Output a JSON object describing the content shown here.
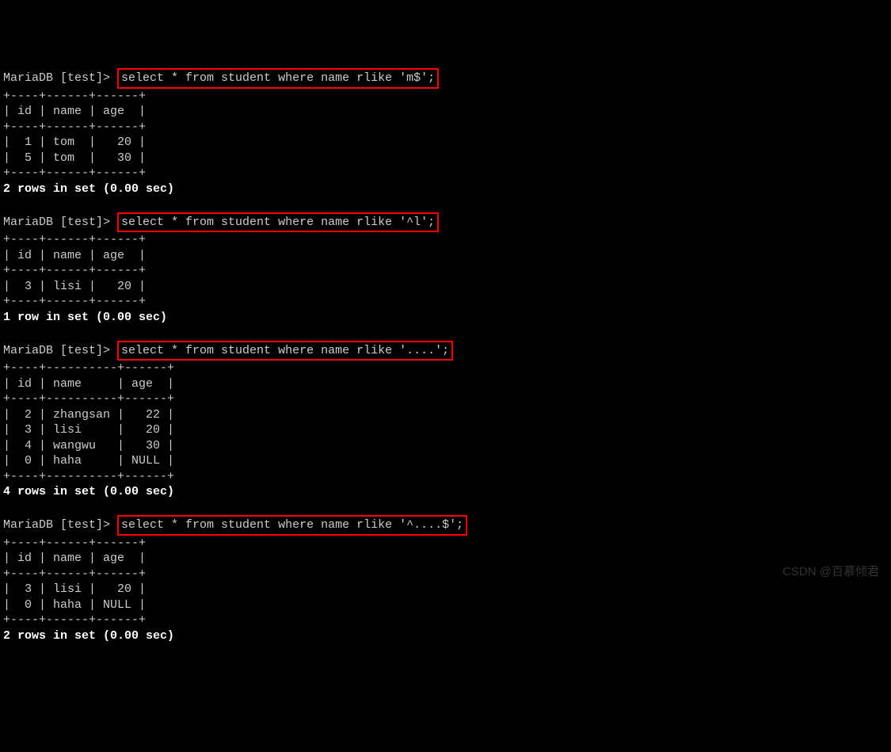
{
  "prompt": "MariaDB [test]> ",
  "queries": [
    {
      "sql": "select * from student where name rlike 'm$';",
      "header": "| id | name | age  |",
      "separator": "+----+------+------+",
      "rows": [
        "|  1 | tom  |   20 |",
        "|  5 | tom  |   30 |"
      ],
      "footer": "2 rows in set (0.00 sec)"
    },
    {
      "sql": "select * from student where name rlike '^l';",
      "header": "| id | name | age  |",
      "separator": "+----+------+------+",
      "rows": [
        "|  3 | lisi |   20 |"
      ],
      "footer": "1 row in set (0.00 sec)"
    },
    {
      "sql": "select * from student where name rlike '....';",
      "header": "| id | name     | age  |",
      "separator": "+----+----------+------+",
      "rows": [
        "|  2 | zhangsan |   22 |",
        "|  3 | lisi     |   20 |",
        "|  4 | wangwu   |   30 |",
        "|  0 | haha     | NULL |"
      ],
      "footer": "4 rows in set (0.00 sec)"
    },
    {
      "sql": "select * from student where name rlike '^....$';",
      "header": "| id | name | age  |",
      "separator": "+----+------+------+",
      "rows": [
        "|  3 | lisi |   20 |",
        "|  0 | haha | NULL |"
      ],
      "footer": "2 rows in set (0.00 sec)"
    }
  ],
  "watermark": "CSDN @百慕倾君"
}
